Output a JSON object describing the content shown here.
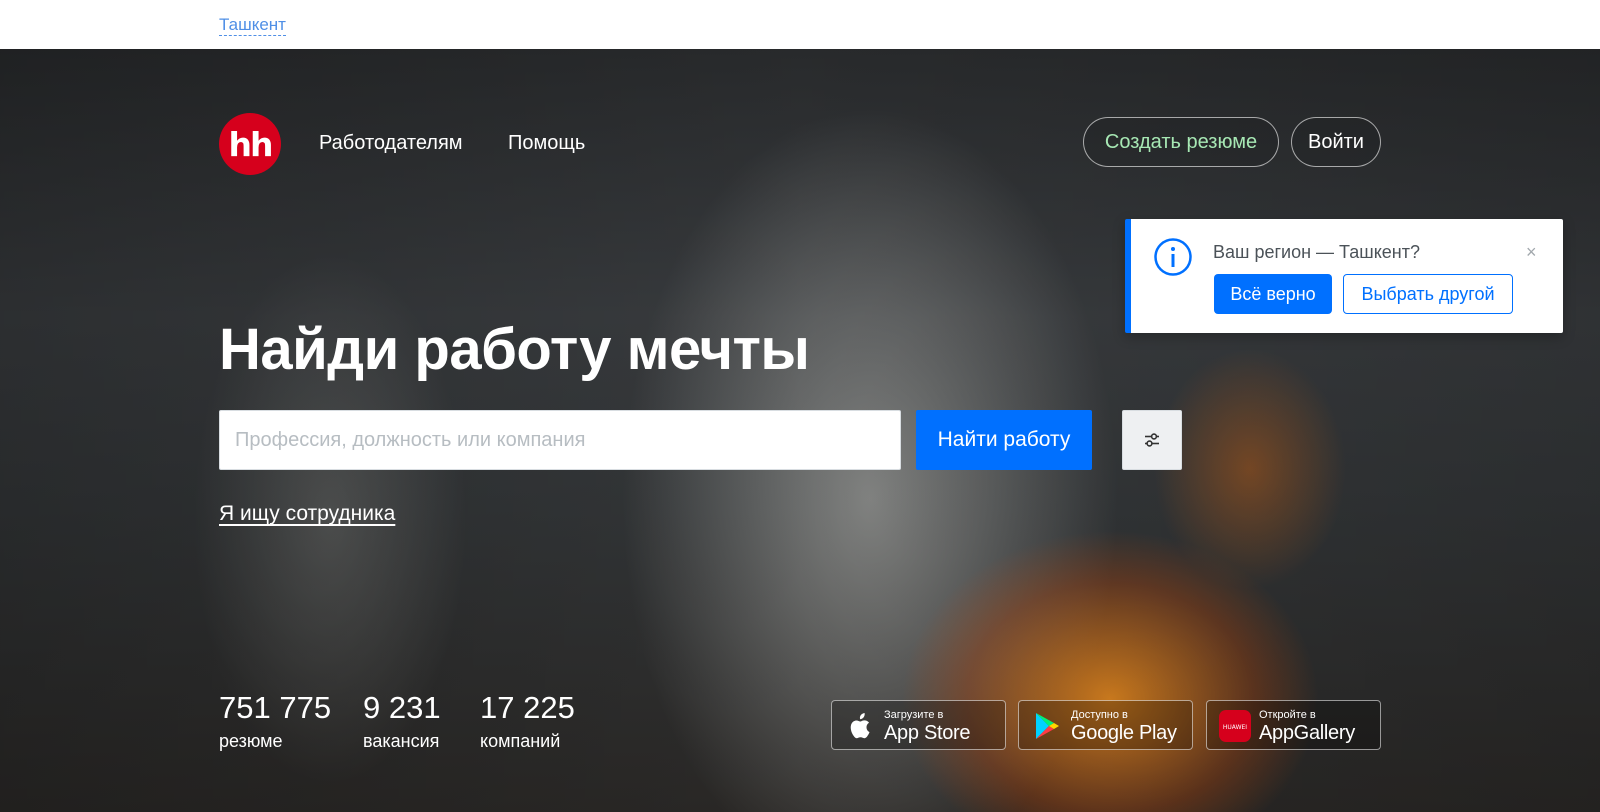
{
  "topbar": {
    "region": "Ташкент"
  },
  "header": {
    "logo_text": "hh",
    "nav": [
      {
        "label": "Работодателям"
      },
      {
        "label": "Помощь"
      }
    ],
    "create_resume": "Создать резюме",
    "login": "Войти"
  },
  "region_popup": {
    "question": "Ваш регион — Ташкент?",
    "confirm": "Всё верно",
    "choose_other": "Выбрать другой",
    "close": "×"
  },
  "hero": {
    "headline": "Найди работу мечты",
    "search": {
      "placeholder": "Профессия, должность или компания",
      "value": ""
    },
    "search_button": "Найти работу",
    "employer_link": "Я ищу сотрудника"
  },
  "stats": [
    {
      "value": "751 775",
      "label": "резюме"
    },
    {
      "value": "9 231",
      "label": "вакансия"
    },
    {
      "value": "17 225",
      "label": "компаний"
    }
  ],
  "stores": [
    {
      "small": "Загрузите в",
      "big": "App Store",
      "icon": "apple-icon"
    },
    {
      "small": "Доступно в",
      "big": "Google Play",
      "icon": "google-play-icon"
    },
    {
      "small": "Откройте в",
      "big": "AppGallery",
      "icon": "huawei-icon",
      "icon_text": "HUAWEI"
    }
  ],
  "colors": {
    "accent": "#0070ff",
    "brand": "#d6001c",
    "create_resume_text": "#a7e8b4"
  }
}
